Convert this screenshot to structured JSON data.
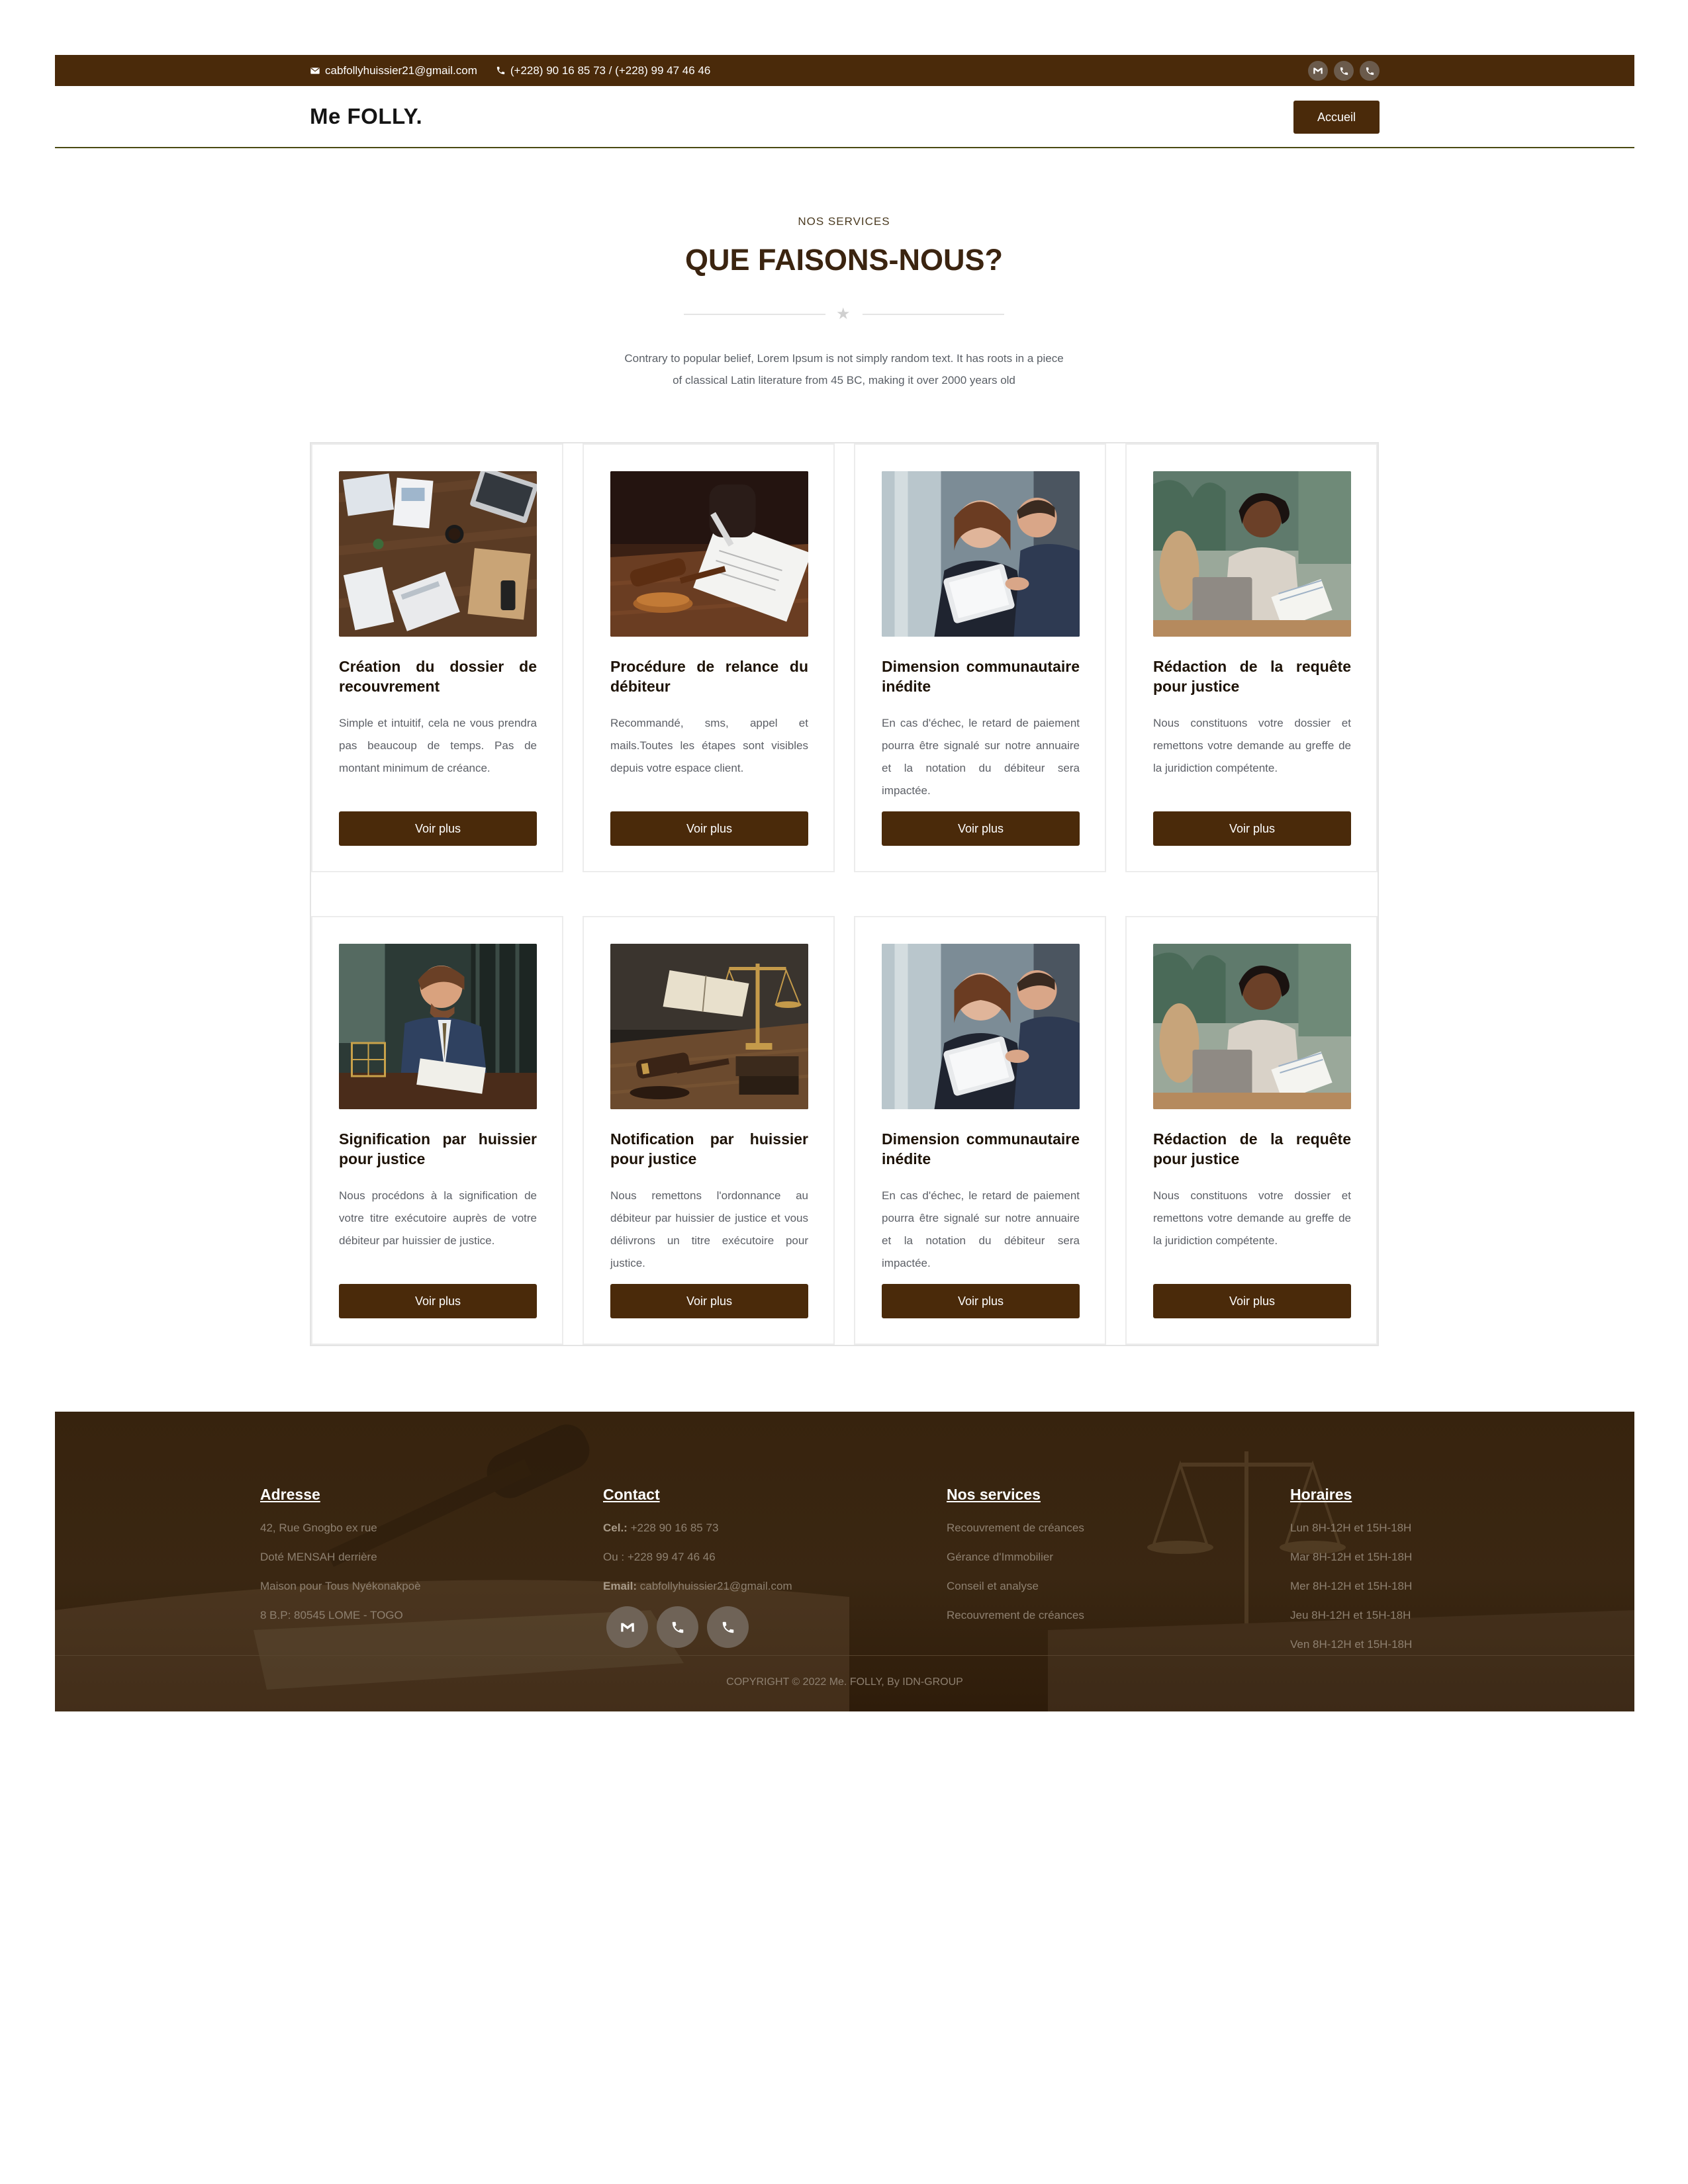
{
  "topbar": {
    "email": "cabfollyhuissier21@gmail.com",
    "phones": "(+228) 90 16 85 73 / (+228) 99 47 46 46",
    "social_icons": [
      "gmail-icon",
      "phone-icon",
      "phone-icon"
    ]
  },
  "nav": {
    "brand": "Me FOLLY.",
    "button": "Accueil"
  },
  "section": {
    "kicker": "NOS SERVICES",
    "title": "QUE FAISONS-NOUS?",
    "divider_icon": "star-icon",
    "description": "Contrary to popular belief, Lorem Ipsum is not simply random text. It has roots in a piece of classical Latin literature from 45 BC, making it over 2000 years old"
  },
  "cards": [
    {
      "title": "Création du dossier de recouvrement",
      "text": "Simple et intuitif, cela ne vous prendra pas beaucoup de temps. Pas de montant minimum de créance.",
      "button": "Voir plus",
      "image": "office-desk-photo"
    },
    {
      "title": "Procédure de relance du débiteur",
      "text": "Recommandé, sms, appel et mails.Toutes les étapes sont visibles depuis votre espace client.",
      "button": "Voir plus",
      "image": "gavel-signing-photo"
    },
    {
      "title": "Dimension communautaire inédite",
      "text": "En cas d'échec, le retard de paiement pourra être signalé sur notre annuaire et la notation du débiteur sera impactée.",
      "button": "Voir plus",
      "image": "business-meeting-photo"
    },
    {
      "title": "Rédaction de la requête pour justice",
      "text": "Nous constituons votre dossier et remettons votre demande au greffe de la juridiction compétente.",
      "button": "Voir plus",
      "image": "woman-laptop-photo"
    },
    {
      "title": "Signification par huissier pour justice",
      "text": "Nous procédons à la signification de votre titre exécutoire auprès de votre débiteur par huissier de justice.",
      "button": "Voir plus",
      "image": "lawyer-writing-photo"
    },
    {
      "title": "Notification par huissier pour justice",
      "text": "Nous remettons l'ordonnance au débiteur par huissier de justice et vous délivrons un titre exécutoire pour justice.",
      "button": "Voir plus",
      "image": "scales-gavel-photo"
    },
    {
      "title": "Dimension communautaire inédite",
      "text": "En cas d'échec, le retard de paiement pourra être signalé sur notre annuaire et la notation du débiteur sera impactée.",
      "button": "Voir plus",
      "image": "business-meeting-photo"
    },
    {
      "title": "Rédaction de la requête pour justice",
      "text": "Nous constituons votre dossier et remettons votre demande au greffe de la juridiction compétente.",
      "button": "Voir plus",
      "image": "woman-laptop-photo"
    }
  ],
  "footer": {
    "address": {
      "title": "Adresse",
      "lines": [
        "42, Rue Gnogbo ex rue",
        "Doté MENSAH derrière",
        "Maison pour Tous Nyékonakpoè",
        "8 B.P: 80545 LOME - TOGO"
      ]
    },
    "contact": {
      "title": "Contact",
      "cel_label": "Cel.:",
      "cel_value": "+228 90 16 85 73",
      "ou_text": "Ou : +228 99 47 46 46",
      "email_label": "Email:",
      "email_value": "cabfollyhuissier21@gmail.com"
    },
    "services": {
      "title": "Nos services",
      "items": [
        "Recouvrement de créances",
        "Gérance d'Immobilier",
        "Conseil et analyse",
        "Recouvrement de créances"
      ]
    },
    "hours": {
      "title": "Horaires",
      "items": [
        "Lun 8H-12H et 15H-18H",
        "Mar 8H-12H et 15H-18H",
        "Mer 8H-12H et 15H-18H",
        "Jeu 8H-12H et 15H-18H",
        "Ven 8H-12H et 15H-18H"
      ]
    },
    "copyright": "COPYRIGHT © 2022 Me. FOLLY, By IDN-GROUP"
  },
  "colors": {
    "brand_brown": "#4a2a0a",
    "footer_bg": "#37230e",
    "title_brown": "#3b2410"
  }
}
